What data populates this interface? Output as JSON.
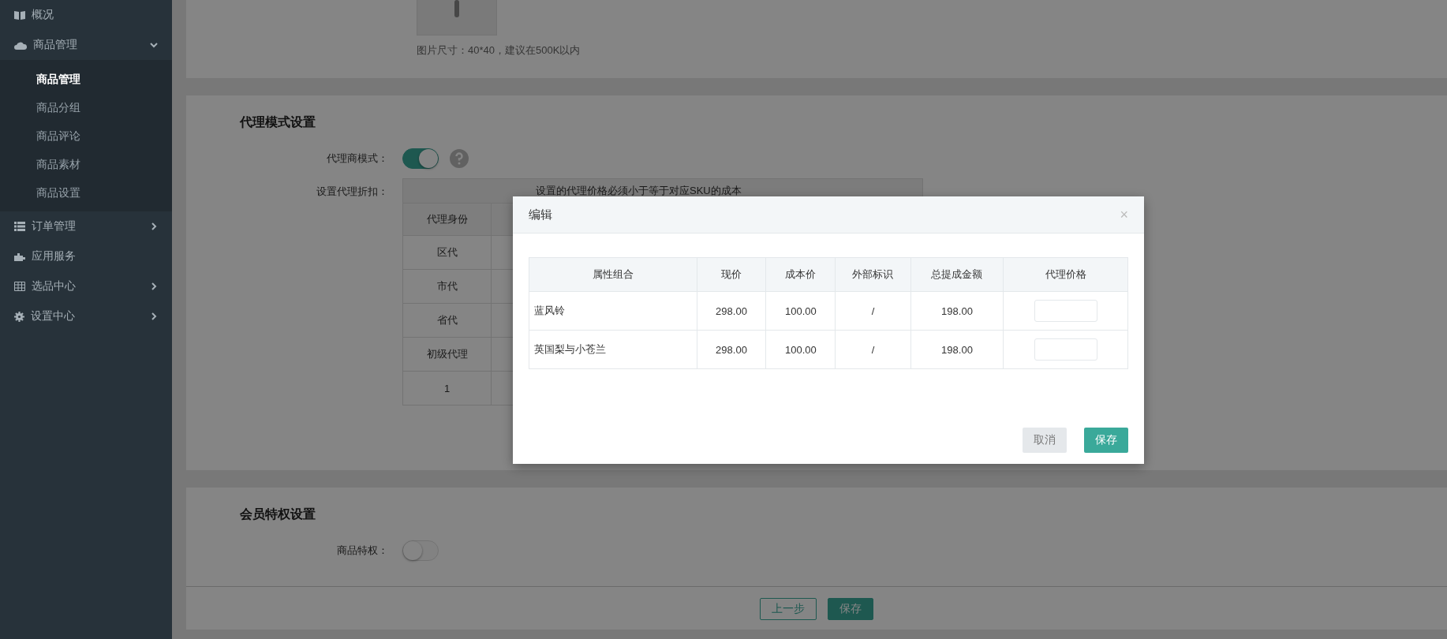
{
  "sidebar": {
    "items": [
      {
        "label": "概况"
      },
      {
        "label": "商品管理",
        "expanded": true,
        "children": [
          {
            "label": "商品管理",
            "selected": true
          },
          {
            "label": "商品分组",
            "selected": false
          },
          {
            "label": "商品评论",
            "selected": false
          },
          {
            "label": "商品素材",
            "selected": false
          },
          {
            "label": "商品设置",
            "selected": false
          }
        ]
      },
      {
        "label": "订单管理",
        "expanded": false
      },
      {
        "label": "应用服务"
      },
      {
        "label": "选品中心",
        "expanded": false
      },
      {
        "label": "设置中心",
        "expanded": false
      }
    ]
  },
  "image_section": {
    "hint": "图片尺寸：40*40，建议在500K以内"
  },
  "agent_section": {
    "title": "代理模式设置",
    "mode_label": "代理商模式：",
    "mode_on": true,
    "discount_label": "设置代理折扣：",
    "notice": "设置的代理价格必须小于等于对应SKU的成本",
    "column": "代理身份",
    "rows": [
      "区代",
      "市代",
      "省代",
      "初级代理",
      "1"
    ]
  },
  "member_section": {
    "title": "会员特权设置",
    "privilege_label": "商品特权：",
    "privilege_on": false
  },
  "footer": {
    "buttons": [
      "上一步",
      "保存"
    ]
  },
  "dialog": {
    "title": "编辑",
    "close": "×",
    "columns": [
      "属性组合",
      "现价",
      "成本价",
      "外部标识",
      "总提成金额",
      "代理价格"
    ],
    "rows": [
      {
        "name": "蓝风铃",
        "price": "298.00",
        "cost": "100.00",
        "external_id": "/",
        "commission": "198.00"
      },
      {
        "name": "英国梨与小苍兰",
        "price": "298.00",
        "cost": "100.00",
        "external_id": "/",
        "commission": "198.00"
      }
    ],
    "buttons": [
      "取消",
      "保存"
    ]
  }
}
